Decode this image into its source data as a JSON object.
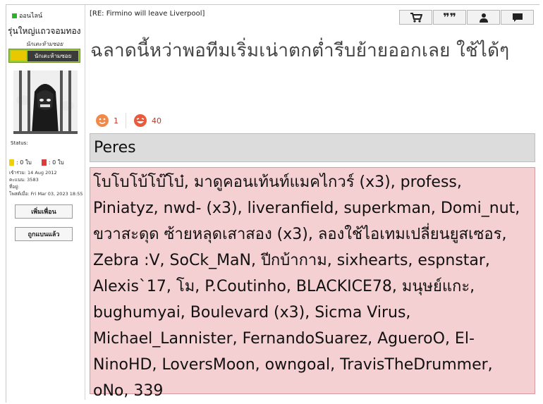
{
  "sidebar": {
    "online_label": "ออนไลน์",
    "rank": "รุ่นใหญ่แถวจอมทอง",
    "subrank": "นักเตะห้ามซอย",
    "award_label": "นักเตะห้ามซอย",
    "status_label": "Status:",
    "yellow_cards": ": 0 ใบ",
    "red_cards": ": 0 ใบ",
    "joined": "เข้าร่วม: 14 Aug 2012",
    "points": "คะแนน: 3583",
    "location": "ที่อยู่:",
    "last_post": "โพสต์เมื่อ: Fri Mar 03, 2023 18:55",
    "add_friend_label": "เพิ่มเพื่อน",
    "banned_label": "ถูกแบนแล้ว",
    "colors": {
      "online": "#2db22d",
      "award_bg": "#9acd32",
      "yellow_card": "#f2d000",
      "red_card": "#e03a3a"
    }
  },
  "post": {
    "title": "[RE: Firmino will leave Liverpool]",
    "toolbar": {
      "icons": [
        "cart-icon",
        "quote-icon",
        "user-icon",
        "message-icon"
      ]
    },
    "message": "ฉลาดนี้หว่าพอทีมเริ่มเน่าตกต่ำรีบย้ายออกเลย ใช้ได้ๆ",
    "reactions": [
      {
        "icon": "like-face-icon",
        "count": "1"
      },
      {
        "icon": "laugh-face-icon",
        "count": "40"
      }
    ],
    "header_box": "Peres",
    "list_box": "โบโบโบ้โบ๊โบ๋, มาดูคอนเท้นท์แมคไกวร์ (x3), profess, Piniatyz, nwd- (x3), liveranfield, superkman, Domi_nut, ขวาสะดุด ซ้ายหลุดเสาสอง (x3), ลองใช้ไอเทมเปลี่ยนยูสเซอร, Zebra :V, SoCk_MaN, ปีกบ้ากาม, sixhearts, espnstar, Alexis`17, โม, P.Coutinho, BLACKICE78, มนุษย์แกะ, bughumyai, Boulevard (x3), Sicma Virus, Michael_Lannister, FernandoSuarez, AgueroO, El-NinoHD, LoversMoon, owngoal, TravisTheDrummer, oNo, 339",
    "colors": {
      "header_bg": "#dcdcdc",
      "list_bg": "#f5d0d3",
      "reaction_count": "#c0392b"
    }
  }
}
